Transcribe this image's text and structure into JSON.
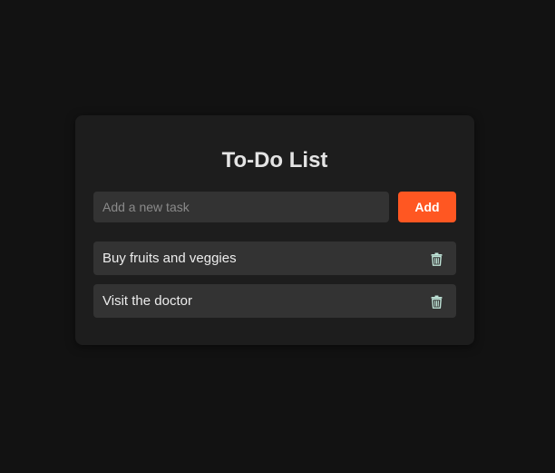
{
  "app": {
    "title": "To-Do List"
  },
  "new_task": {
    "value": "",
    "placeholder": "Add a new task",
    "add_label": "Add"
  },
  "tasks": [
    {
      "text": "Buy fruits and veggies",
      "delete_icon": "trash-icon"
    },
    {
      "text": "Visit the doctor",
      "delete_icon": "trash-icon"
    }
  ],
  "colors": {
    "page_background": "#121212",
    "card_background": "#1d1d1d",
    "item_background": "#333333",
    "accent": "#ff5722",
    "trash_icon": "#bfe3d7"
  }
}
